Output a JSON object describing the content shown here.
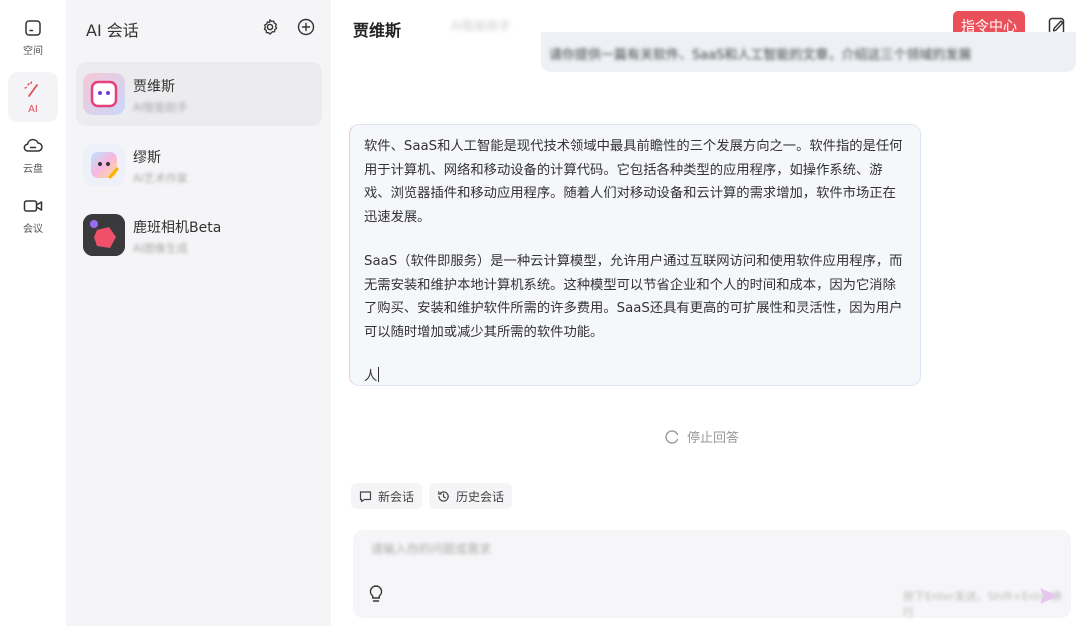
{
  "rail": {
    "items": [
      {
        "label": "空间",
        "icon": "space-icon"
      },
      {
        "label": "AI",
        "icon": "magic-wand-icon",
        "active": true
      },
      {
        "label": "云盘",
        "icon": "cloud-icon"
      },
      {
        "label": "会议",
        "icon": "video-icon"
      }
    ]
  },
  "sidebar": {
    "title": "AI 会话",
    "sessions": [
      {
        "name": "贾维斯",
        "desc": "AI智能助手",
        "active": true
      },
      {
        "name": "缪斯",
        "desc": "AI艺术作家"
      },
      {
        "name": "鹿班相机Beta",
        "desc": "AI图像生成"
      }
    ]
  },
  "chat": {
    "title": "贾维斯",
    "header_blur": "AI智能助手",
    "command_button": "指令中心",
    "previous_message": "请你提供一篇有关软件、SaaS和人工智能的文章，介绍这三个领域的发展",
    "reply": {
      "p1": "软件、SaaS和人工智能是现代技术领域中最具前瞻性的三个发展方向之一。软件指的是任何用于计算机、网络和移动设备的计算代码。它包括各种类型的应用程序，如操作系统、游戏、浏览器插件和移动应用程序。随着人们对移动设备和云计算的需求增加，软件市场正在迅速发展。",
      "p2": "SaaS（软件即服务）是一种云计算模型，允许用户通过互联网访问和使用软件应用程序，而无需安装和维护本地计算机系统。这种模型可以节省企业和个人的时间和成本，因为它消除了购买、安装和维护软件所需的许多费用。SaaS还具有更高的可扩展性和灵活性，因为用户可以随时增加或减少其所需的软件功能。",
      "p3": "人"
    },
    "stop_label": "停止回答",
    "new_chat_label": "新会话",
    "history_label": "历史会话",
    "input_placeholder": "请输入你的问题或需求",
    "send_hint": "按下Enter发送，Shift+Enter换行"
  },
  "colors": {
    "accent": "#e9505a",
    "sidebar_bg": "#f5f5f7",
    "reply_bg": "#f6f7fb"
  }
}
